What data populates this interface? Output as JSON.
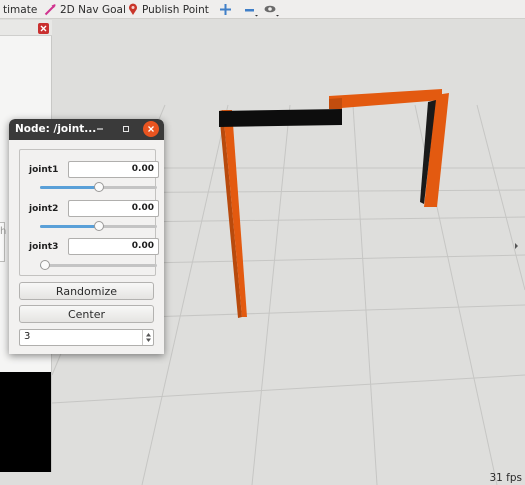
{
  "toolbar": {
    "items": [
      {
        "label": "timate",
        "icon": "none"
      },
      {
        "label": "2D Nav Goal",
        "icon": "pink-arrow-icon"
      },
      {
        "label": "Publish Point",
        "icon": "red-location-pin-icon"
      }
    ],
    "tool_icons": [
      "move-camera-plus-icon",
      "minus-icon",
      "eye-icon"
    ]
  },
  "viewport": {
    "fps_label": "31 fps",
    "background_color": "#dededc",
    "robot_colors": {
      "link": "#e35a10",
      "joint": "#000000"
    }
  },
  "dialog": {
    "title": "Node: /joint...",
    "joints": [
      {
        "label": "joint1",
        "value": "0.00",
        "slider_fraction": 0.5
      },
      {
        "label": "joint2",
        "value": "0.00",
        "slider_fraction": 0.5
      },
      {
        "label": "joint3",
        "value": "0.00",
        "slider_fraction": 0.0
      }
    ],
    "randomize_label": "Randomize",
    "center_label": "Center",
    "spinbox_value": "3"
  },
  "left_panel": {
    "fragment": "he"
  },
  "colors": {
    "dialog_title_bg": "#3a3a3a",
    "close_button": "#e95420",
    "slider_fill": "#5aa0d8"
  }
}
